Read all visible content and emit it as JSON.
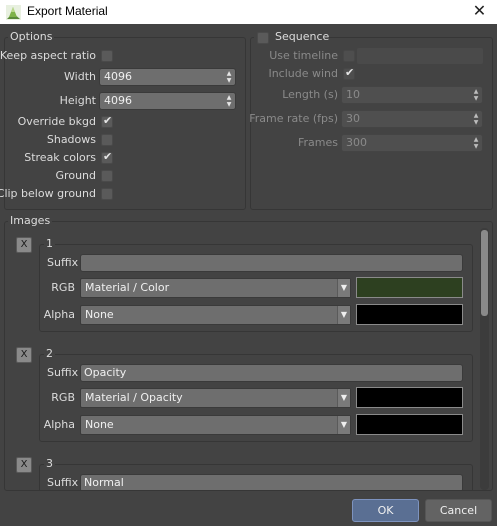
{
  "window": {
    "title": "Export Material",
    "close_glyph": "✕"
  },
  "options": {
    "title": "Options",
    "keep_aspect_ratio": {
      "label": "Keep aspect ratio",
      "checked": false
    },
    "width": {
      "label": "Width",
      "value": "4096"
    },
    "height": {
      "label": "Height",
      "value": "4096"
    },
    "override_bkgd": {
      "label": "Override bkgd",
      "checked": true
    },
    "shadows": {
      "label": "Shadows",
      "checked": false
    },
    "streak_colors": {
      "label": "Streak colors",
      "checked": true
    },
    "ground": {
      "label": "Ground",
      "checked": false
    },
    "clip_below_ground": {
      "label": "Clip below ground",
      "checked": false
    }
  },
  "sequence": {
    "title": "Sequence",
    "enabled": false,
    "use_timeline": {
      "label": "Use timeline",
      "checked": false
    },
    "include_wind": {
      "label": "Include wind",
      "checked": true
    },
    "length": {
      "label": "Length (s)",
      "value": "10"
    },
    "frame_rate": {
      "label": "Frame rate (fps)",
      "value": "30"
    },
    "frames": {
      "label": "Frames",
      "value": "300"
    }
  },
  "images": {
    "title": "Images",
    "remove_label": "X",
    "suffix_label": "Suffix",
    "rgb_label": "RGB",
    "alpha_label": "Alpha",
    "items": [
      {
        "index": "1",
        "suffix": "",
        "rgb": "Material / Color",
        "rgb_color": "#2d4020",
        "alpha": "None",
        "alpha_color": "#000000"
      },
      {
        "index": "2",
        "suffix": "Opacity",
        "rgb": "Material / Opacity",
        "rgb_color": "#000000",
        "alpha": "None",
        "alpha_color": "#000000"
      },
      {
        "index": "3",
        "suffix": "Normal"
      }
    ]
  },
  "buttons": {
    "ok": "OK",
    "cancel": "Cancel"
  },
  "icons": {
    "app": "speedtree-leaf-icon",
    "dropdown": "chevron-down-icon",
    "spin_up": "arrow-up-icon",
    "spin_down": "arrow-down-icon",
    "check": "check-icon"
  }
}
